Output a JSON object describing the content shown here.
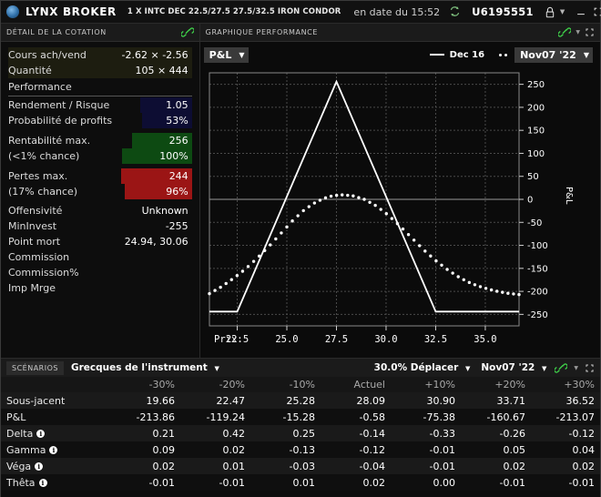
{
  "titlebar": {
    "brand": "LYNX BROKER",
    "description": "1 X INTC DEC 22.5/27.5 27.5/32.5 IRON CONDOR",
    "date_label": "en date du 15:52",
    "refresh_icon": "refresh-icon",
    "account": "U6195551",
    "lock_icon": "lock-icon",
    "caret_icon": "chevron-down-icon",
    "minimize": "—",
    "maximize": "⬚",
    "close": "✕"
  },
  "quote_panel": {
    "title": "DÉTAIL DE LA COTATION",
    "link_icon": "link-icon",
    "rows": [
      {
        "label": "Cours ach/vend",
        "value": "-2.62 × -2.56",
        "style": "olive"
      },
      {
        "label": "Quantité",
        "value": "105 × 444",
        "style": "olive"
      }
    ],
    "section_header": "Performance",
    "perf_rows": [
      {
        "label": "Rendement / Risque",
        "value": "1.05",
        "style": "navy"
      },
      {
        "label": "Probabilité de profits",
        "value": "53%",
        "style": "navy"
      },
      {
        "label": "Rentabilité max.",
        "value": "256",
        "style": "green"
      },
      {
        "label": "(<1% chance)",
        "value": "100%",
        "style": "green"
      },
      {
        "label": "Pertes max.",
        "value": "244",
        "style": "red"
      },
      {
        "label": "(17% chance)",
        "value": "96%",
        "style": "red"
      },
      {
        "label": "Offensivité",
        "value": "Unknown",
        "style": "none"
      },
      {
        "label": "MinInvest",
        "value": "-255",
        "style": "none"
      },
      {
        "label": "Point mort",
        "value": "24.94, 30.06",
        "style": "none"
      },
      {
        "label": "Commission",
        "value": "",
        "style": "none"
      },
      {
        "label": "Commission%",
        "value": "",
        "style": "none"
      },
      {
        "label": "Imp Mrge",
        "value": "",
        "style": "none"
      }
    ]
  },
  "chart_panel": {
    "title": "GRAPHIQUE PERFORMANCE",
    "link_icon": "link-icon",
    "caret_icon": "chevron-down-icon",
    "expand_icon": "expand-icon",
    "metric_dropdown": "P&L",
    "metric_arrow": "▼",
    "legend_line_label": "Dec 16",
    "legend_dots_label": "Nov07 '22",
    "date_dropdown_arrow": "▼"
  },
  "chart_data": {
    "type": "line",
    "title": "Graphique Performance",
    "xlabel": "Prix:",
    "ylabel": "P&L",
    "xlim": [
      21.1,
      36.7
    ],
    "ylim": [
      -275,
      275
    ],
    "xticks": [
      22.5,
      25.0,
      27.5,
      30.0,
      32.5,
      35.0
    ],
    "xtick_labels": [
      "22.5",
      "25.0",
      "27.5",
      "30.0",
      "32.5",
      "35.0"
    ],
    "yticks": [
      250,
      200,
      150,
      100,
      50,
      0,
      -50,
      -100,
      -150,
      -200,
      -250
    ],
    "ytick_labels": [
      "250",
      "200",
      "150",
      "100",
      "50",
      "0",
      "-50",
      "-100",
      "-150",
      "-200",
      "-250"
    ],
    "grid": true,
    "legend_position": "top-right",
    "series": [
      {
        "name": "Dec 16",
        "style": "solid",
        "color": "#ffffff",
        "comment": "Iron condor expiry payoff",
        "x": [
          21.1,
          22.5,
          27.5,
          32.5,
          36.7
        ],
        "y": [
          -244,
          -244,
          256,
          -244,
          -244
        ]
      },
      {
        "name": "Nov07 '22",
        "style": "dotted",
        "color": "#ffffff",
        "comment": "Current theoretical P&L curve",
        "x": [
          21.1,
          21.7,
          22.3,
          22.9,
          23.5,
          24.1,
          24.7,
          25.3,
          25.9,
          26.5,
          27.1,
          27.7,
          28.3,
          28.9,
          29.5,
          30.1,
          30.7,
          31.3,
          31.9,
          32.5,
          33.1,
          33.7,
          34.3,
          34.9,
          35.5,
          36.1,
          36.7
        ],
        "y": [
          -205,
          -190,
          -172,
          -152,
          -128,
          -102,
          -74,
          -46,
          -22,
          -5,
          6,
          10,
          8,
          0,
          -14,
          -34,
          -58,
          -84,
          -110,
          -133,
          -153,
          -170,
          -183,
          -192,
          -199,
          -204,
          -207
        ]
      }
    ]
  },
  "scenarios": {
    "tab_label": "SCÉNARIOS",
    "selector": "Grecques de l'instrument",
    "selector_arrow": "▼",
    "move_label": "30.0% Déplacer",
    "move_arrow": "▼",
    "date_label": "Nov07 '22",
    "date_arrow": "▼",
    "link_icon": "link-icon",
    "caret_icon": "chevron-down-icon",
    "expand_icon": "expand-icon",
    "columns": [
      "",
      "-30%",
      "-20%",
      "-10%",
      "Actuel",
      "+10%",
      "+20%",
      "+30%"
    ],
    "rows": [
      {
        "label": "Sous-jacent",
        "info": false,
        "values": [
          "19.66",
          "22.47",
          "25.28",
          "28.09",
          "30.90",
          "33.71",
          "36.52"
        ]
      },
      {
        "label": "P&L",
        "info": false,
        "values": [
          "-213.86",
          "-119.24",
          "-15.28",
          "-0.58",
          "-75.38",
          "-160.67",
          "-213.07"
        ]
      },
      {
        "label": "Delta",
        "info": true,
        "values": [
          "0.21",
          "0.42",
          "0.25",
          "-0.14",
          "-0.33",
          "-0.26",
          "-0.12"
        ]
      },
      {
        "label": "Gamma",
        "info": true,
        "values": [
          "0.09",
          "0.02",
          "-0.13",
          "-0.12",
          "-0.01",
          "0.05",
          "0.04"
        ]
      },
      {
        "label": "Véga",
        "info": true,
        "values": [
          "0.02",
          "0.01",
          "-0.03",
          "-0.04",
          "-0.01",
          "0.02",
          "0.02"
        ]
      },
      {
        "label": "Thêta",
        "info": true,
        "values": [
          "-0.01",
          "-0.01",
          "0.01",
          "0.02",
          "0.00",
          "-0.01",
          "-0.01"
        ]
      }
    ],
    "info_glyph": "i"
  },
  "colors": {
    "accent_green": "#3fd24a",
    "profit_green": "#0d4a12",
    "loss_red": "#9b1515",
    "navy": "#0d0d33",
    "olive": "#1d1d10"
  }
}
